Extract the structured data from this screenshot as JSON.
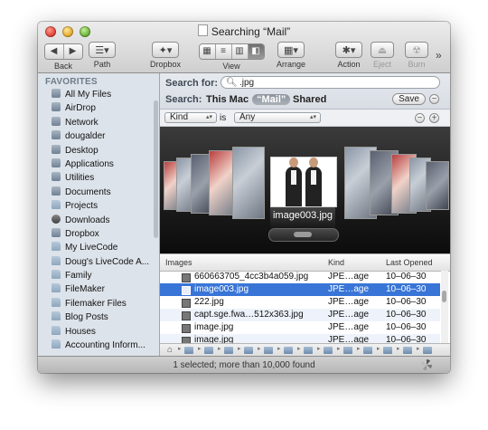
{
  "window": {
    "title": "Searching “Mail”"
  },
  "toolbar": {
    "back_label": "Back",
    "path_label": "Path",
    "dropbox_label": "Dropbox",
    "view_label": "View",
    "arrange_label": "Arrange",
    "action_label": "Action",
    "eject_label": "Eject",
    "burn_label": "Burn"
  },
  "sidebar": {
    "heading": "FAVORITES",
    "items": [
      {
        "label": "All My Files",
        "icon": "all-files-icon"
      },
      {
        "label": "AirDrop",
        "icon": "airdrop-icon"
      },
      {
        "label": "Network",
        "icon": "network-icon"
      },
      {
        "label": "dougalder",
        "icon": "home-icon"
      },
      {
        "label": "Desktop",
        "icon": "desktop-icon"
      },
      {
        "label": "Applications",
        "icon": "applications-icon"
      },
      {
        "label": "Utilities",
        "icon": "utilities-icon"
      },
      {
        "label": "Documents",
        "icon": "documents-icon"
      },
      {
        "label": "Projects",
        "icon": "folder-icon"
      },
      {
        "label": "Downloads",
        "icon": "downloads-icon"
      },
      {
        "label": "Dropbox",
        "icon": "dropbox-icon"
      },
      {
        "label": "My LiveCode",
        "icon": "folder-icon"
      },
      {
        "label": "Doug's LiveCode A...",
        "icon": "folder-icon"
      },
      {
        "label": "Family",
        "icon": "folder-icon"
      },
      {
        "label": "FileMaker",
        "icon": "folder-icon"
      },
      {
        "label": "Filemaker Files",
        "icon": "folder-icon"
      },
      {
        "label": "Blog Posts",
        "icon": "folder-icon"
      },
      {
        "label": "Houses",
        "icon": "folder-icon"
      },
      {
        "label": "Accounting Inform...",
        "icon": "folder-icon"
      }
    ]
  },
  "search": {
    "label": "Search for:",
    "value": ".jpg",
    "scope_label": "Search:",
    "scope_this_mac": "This Mac",
    "scope_mail": "“Mail”",
    "scope_shared": "Shared",
    "save_label": "Save",
    "minus": "−",
    "plus": "+"
  },
  "criteria": {
    "attribute": "Kind",
    "operator": "is",
    "value": "Any"
  },
  "coverflow": {
    "caption": "image003.jpg"
  },
  "list": {
    "columns": [
      "Images",
      "Kind",
      "Last Opened"
    ],
    "rows": [
      {
        "name": "660663705_4cc3b4a059.jpg",
        "kind": "JPE…age",
        "opened": "10–06–30",
        "selected": false
      },
      {
        "name": "image003.jpg",
        "kind": "JPE…age",
        "opened": "10–06–30",
        "selected": true
      },
      {
        "name": "222.jpg",
        "kind": "JPE…age",
        "opened": "10–06–30",
        "selected": false
      },
      {
        "name": "capt.sge.fwa…512x363.jpg",
        "kind": "JPE…age",
        "opened": "10–06–30",
        "selected": false
      },
      {
        "name": "image.jpg",
        "kind": "JPE…age",
        "opened": "10–06–30",
        "selected": false
      },
      {
        "name": "image.jpg",
        "kind": "JPE…age",
        "opened": "10–06–30",
        "selected": false
      }
    ]
  },
  "status": {
    "text": "1 selected; more than 10,000 found"
  }
}
